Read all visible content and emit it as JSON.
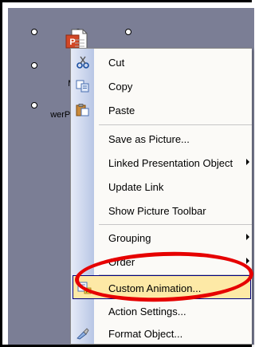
{
  "object": {
    "label_line1": "Micr",
    "label_line2": "werPoint",
    "icon": "powerpoint-document-icon"
  },
  "context_menu": {
    "items": [
      {
        "label": "Cut",
        "icon": "scissors-icon"
      },
      {
        "label": "Copy",
        "icon": "copy-icon"
      },
      {
        "label": "Paste",
        "icon": "clipboard-paste-icon"
      },
      {
        "label": "Save as Picture..."
      },
      {
        "label": "Linked Presentation Object",
        "submenu": true
      },
      {
        "label": "Update Link"
      },
      {
        "label": "Show Picture Toolbar"
      },
      {
        "label": "Grouping",
        "submenu": true
      },
      {
        "label": "Order",
        "submenu": true
      },
      {
        "label": "Custom Animation...",
        "icon": "custom-animation-icon",
        "highlighted": true
      },
      {
        "label": "Action Settings..."
      },
      {
        "label": "Format Object...",
        "icon": "format-object-icon"
      }
    ]
  },
  "colors": {
    "slide_background": "#7b7e95",
    "menu_background": "#fbfaf7",
    "highlight": "#fde9a6",
    "annotation": "#e60000"
  }
}
